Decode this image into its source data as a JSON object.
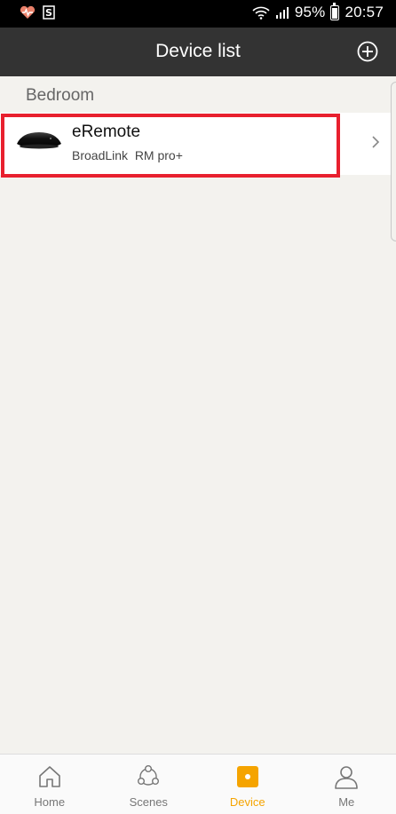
{
  "status_bar": {
    "battery": "95%",
    "time": "20:57"
  },
  "header": {
    "title": "Device list",
    "add_icon": "plus-circle-icon"
  },
  "groups": [
    {
      "label": "Bedroom",
      "devices": [
        {
          "name": "eRemote",
          "model": "BroadLink  RM pro+"
        }
      ]
    }
  ],
  "bottom_nav": {
    "items": [
      {
        "label": "Home",
        "icon": "home-icon"
      },
      {
        "label": "Scenes",
        "icon": "scenes-icon"
      },
      {
        "label": "Device",
        "icon": "device-icon",
        "active": true
      },
      {
        "label": "Me",
        "icon": "person-icon"
      }
    ]
  },
  "colors": {
    "header_bg": "#333333",
    "active_accent": "#f5a400",
    "highlight_border": "#e8202e",
    "page_bg": "#f3f2ee"
  }
}
